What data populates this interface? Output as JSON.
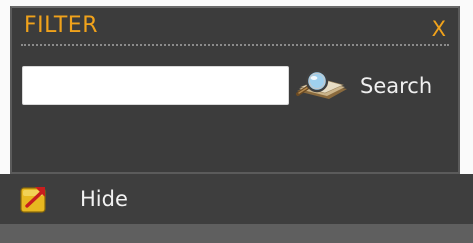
{
  "filter": {
    "title": "FILTER",
    "close_label": "X",
    "search": {
      "value": "",
      "placeholder": "",
      "button_label": "Search",
      "icon": "magnifier-over-papers-icon"
    }
  },
  "footer": {
    "hide_label": "Hide",
    "hide_icon": "collapse-arrow-icon"
  },
  "colors": {
    "accent": "#f0a21b",
    "panel_bg": "#3c3c3c",
    "text": "#f0f0f0"
  }
}
